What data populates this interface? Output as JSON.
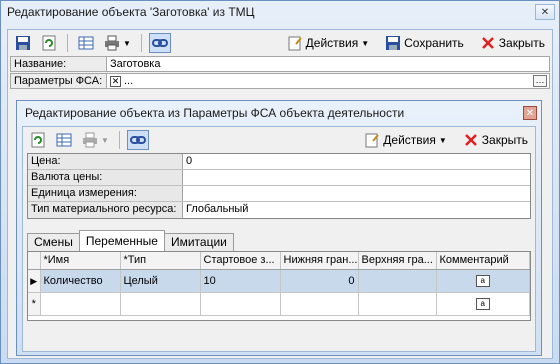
{
  "outer": {
    "title": "Редактирование объекта 'Заготовка' из ТМЦ",
    "toolbar": {
      "actions_label": "Действия",
      "save_label": "Сохранить",
      "close_label": "Закрыть"
    },
    "fields": [
      {
        "label": "Название:",
        "value": "Заготовка"
      },
      {
        "label": "Параметры ФСА:",
        "value": "..."
      }
    ]
  },
  "inner": {
    "title": "Редактирование объекта  из Параметры ФСА объекта деятельности",
    "toolbar": {
      "actions_label": "Действия",
      "close_label": "Закрыть"
    },
    "fields": [
      {
        "label": "Цена:",
        "value": "0"
      },
      {
        "label": "Валюта цены:",
        "value": ""
      },
      {
        "label": "Единица измерения:",
        "value": ""
      },
      {
        "label": "Тип материального ресурса:",
        "value": "Глобальный"
      }
    ],
    "tabs": [
      "Смены",
      "Переменные",
      "Имитации"
    ],
    "active_tab": 1,
    "grid": {
      "columns": [
        "*Имя",
        "*Тип",
        "Стартовое з...",
        "Нижняя гран...",
        "Верхняя гра...",
        "Комментарий"
      ],
      "rows": [
        {
          "marker": "▶",
          "name": "Количество",
          "type": "Целый",
          "start": "10",
          "low": "0",
          "high": ""
        },
        {
          "marker": "*",
          "name": "",
          "type": "",
          "start": "",
          "low": "",
          "high": ""
        }
      ]
    }
  },
  "colors": {
    "accent": "#6a8fc0",
    "selected_row": "#c9d9ec"
  }
}
